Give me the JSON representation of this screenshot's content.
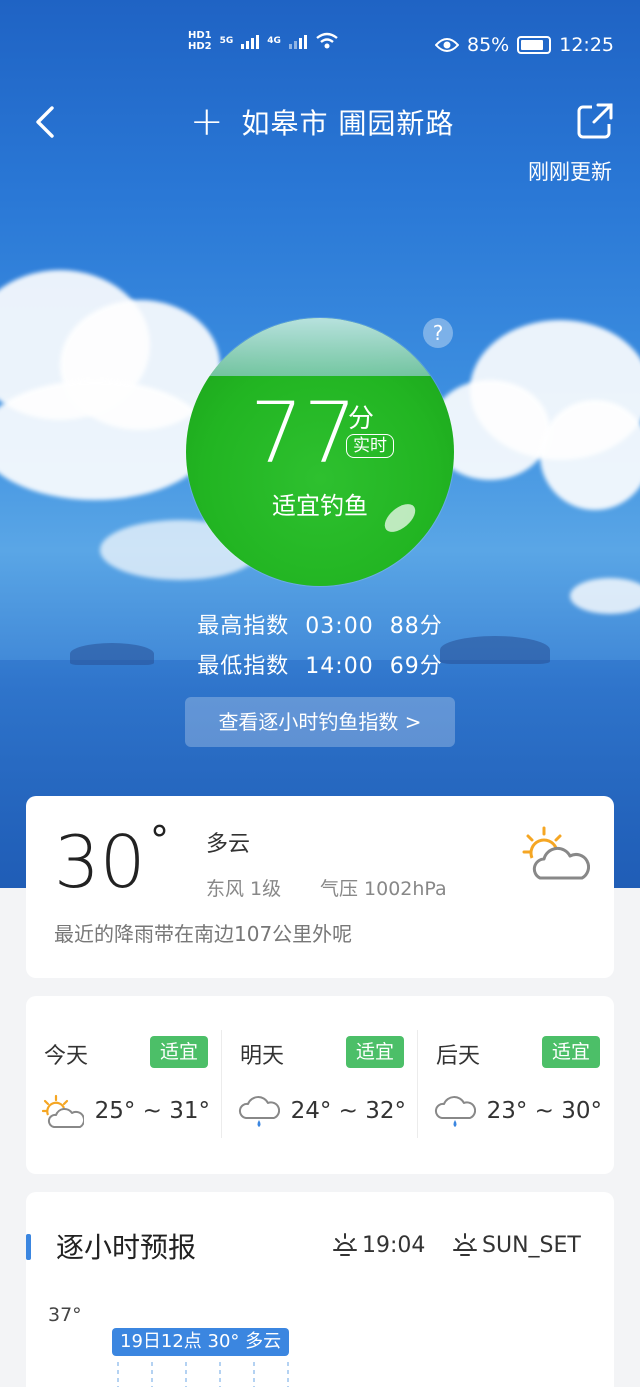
{
  "status_bar": {
    "hd1": "HD",
    "hd2": "HD",
    "net1": "5G",
    "net2": "4G",
    "battery": "85%",
    "time": "12:25"
  },
  "header": {
    "title": "如皋市 圃园新路",
    "updated": "刚刚更新"
  },
  "fishing": {
    "help": "?",
    "score": "77",
    "unit": "分",
    "realtime": "实时",
    "status": "适宜钓鱼",
    "accent_color": "#22b522",
    "max_label": "最高指数",
    "max_time": "03:00",
    "max_score": "88分",
    "min_label": "最低指数",
    "min_time": "14:00",
    "min_score": "69分",
    "hourly_button": "查看逐小时钓鱼指数 >"
  },
  "current": {
    "temp": "30",
    "deg": "°",
    "condition": "多云",
    "wind": "东风  1级",
    "pressure": "气压  1002hPa",
    "rain_note": "最近的降雨带在南边107公里外呢",
    "icon": "partly-cloudy-icon"
  },
  "forecast": [
    {
      "day": "今天",
      "badge": "适宜",
      "range": "25° ~ 31°",
      "icon": "partly-cloudy-icon"
    },
    {
      "day": "明天",
      "badge": "适宜",
      "range": "24° ~ 32°",
      "icon": "rain-cloud-icon"
    },
    {
      "day": "后天",
      "badge": "适宜",
      "range": "23° ~ 30°",
      "icon": "rain-cloud-icon"
    }
  ],
  "hourly": {
    "title": "逐小时预报",
    "sunrise": "19:04",
    "sunset": "SUN_SET",
    "tmax": "37°",
    "tooltip": "19日12点 30° 多云"
  }
}
